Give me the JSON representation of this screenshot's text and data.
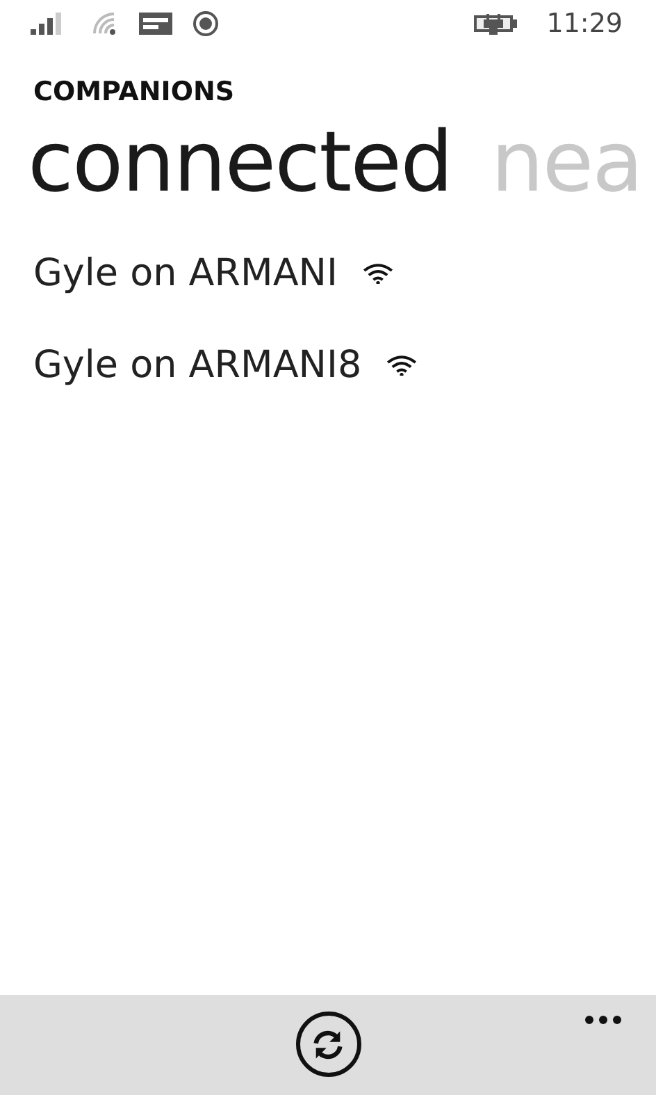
{
  "status_bar": {
    "time": "11:29"
  },
  "app_title": "COMPANIONS",
  "pivots": [
    {
      "label": "connected",
      "selected": true
    },
    {
      "label": "nea",
      "selected": false
    }
  ],
  "companions": [
    {
      "name": "Gyle on ARMANI"
    },
    {
      "name": "Gyle on ARMANI8"
    }
  ]
}
